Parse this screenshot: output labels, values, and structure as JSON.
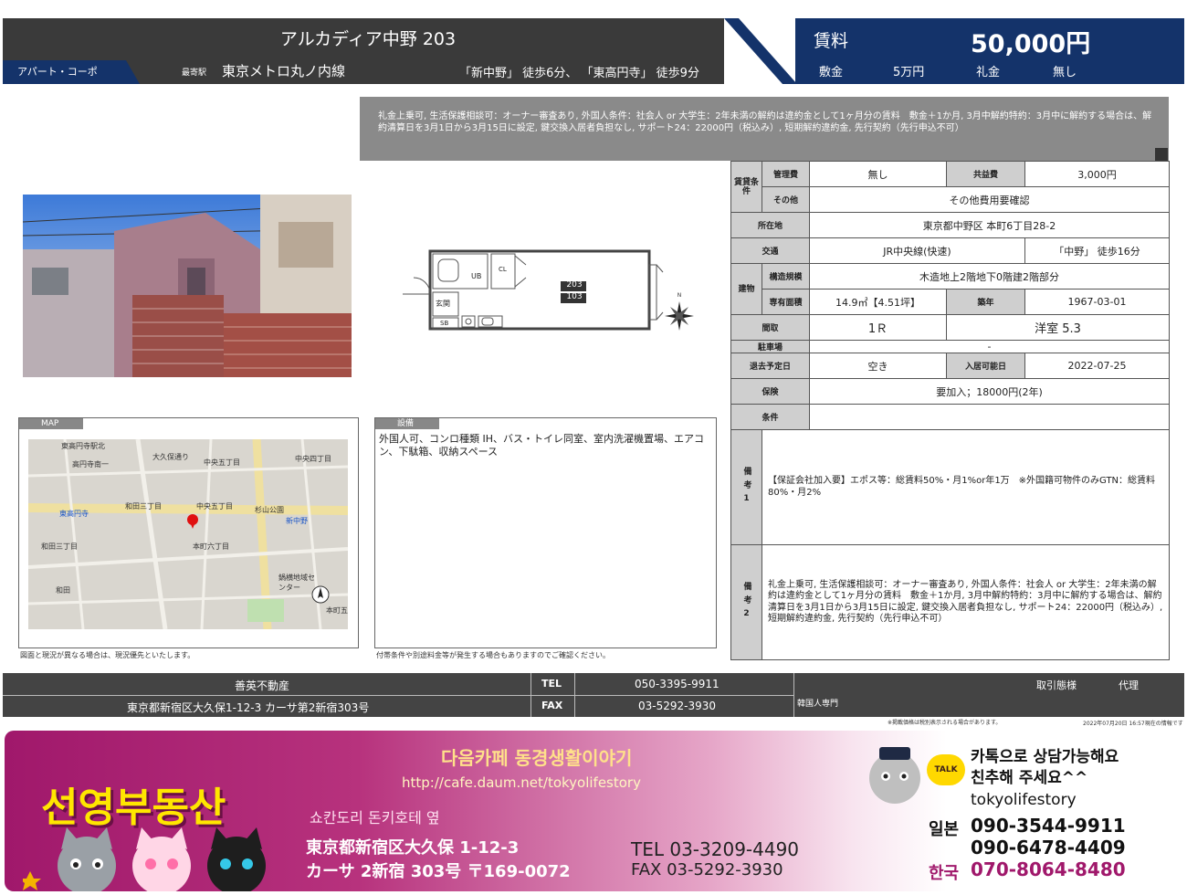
{
  "header": {
    "title": "アルカディア中野 203",
    "type": "アパート・コーポ",
    "nearest_label": "最寄駅",
    "station": "東京メトロ丸ノ内線",
    "walk": "「新中野」 徒歩6分、 「東高円寺」 徒歩9分",
    "rent_label": "賃料",
    "rent": "50,000円",
    "deposit_label": "敷金",
    "deposit": "5万円",
    "key_money_label": "礼金",
    "key_money": "無し"
  },
  "banner_text": "礼金上乗可, 生活保護相談可：オーナー審査あり, 外国人条件：社会人 or 大学生：2年未満の解約は違約金として1ヶ月分の賃料　敷金＋1か月, 3月中解約特約：3月中に解約する場合は、解約清算日を3月1日から3月15日に設定, 鍵交換入居者負担なし, サポート24：22000円（税込み）, 短期解約違約金, 先行契約（先行申込不可）",
  "table": {
    "lease_terms_label": "賃貸条件",
    "mgmt_fee_label": "管理費",
    "mgmt_fee": "無し",
    "common_fee_label": "共益費",
    "common_fee": "3,000円",
    "other_label": "その他",
    "other": "その他費用要確認",
    "address_label": "所在地",
    "address": "東京都中野区 本町6丁目28-2",
    "transport_label": "交通",
    "line": "JR中央線(快速)",
    "line_walk": "「中野」 徒歩16分",
    "building_label": "建物",
    "structure_label": "構造規模",
    "structure": "木造地上2階地下0階建2階部分",
    "area_label": "専有面積",
    "area": "14.9㎡【4.51坪】",
    "built_label": "築年",
    "built": "1967-03-01",
    "layout_label": "間取",
    "layout": "1Ｒ",
    "room": "洋室 5.3",
    "parking_label": "駐車場",
    "parking": "-",
    "moveout_label": "退去予定日",
    "moveout": "空き",
    "movein_label": "入居可能日",
    "movein": "2022-07-25",
    "insurance_label": "保険",
    "insurance": "要加入；18000円(2年)",
    "conditions_label": "条件",
    "conditions": "",
    "remark1_label": "備考1",
    "remark1": "【保証会社加入要】エポス等：総賃料50%・月1%or年1万　※外国籍可物件のみGTN：総賃料80%・月2%",
    "remark2_label": "備考2",
    "remark2": "礼金上乗可, 生活保護相談可：オーナー審査あり, 外国人条件：社会人 or 大学生：2年未満の解約は違約金として1ヶ月分の賃料　敷金＋1か月, 3月中解約特約：3月中に解約する場合は、解約清算日を3月1日から3月15日に設定, 鍵交換入居者負担なし, サポート24：22000円（税込み）, 短期解約違約金, 先行契約（先行申込不可）"
  },
  "floorplan": {
    "room_top": "203",
    "room_bottom": "103",
    "ub": "UB",
    "cl": "CL",
    "entrance": "玄関",
    "sb": "SB"
  },
  "map": {
    "label": "MAP",
    "note": "図面と現況が異なる場合は、現況優先といたします。",
    "places": {
      "p1": "東高円寺駅北",
      "p2": "高円寺南一",
      "p3": "大久保通り",
      "p4": "中央五丁目",
      "p5": "中央四丁目",
      "p6": "和田三丁目",
      "p7": "中央五丁目",
      "p8": "杉山公園",
      "p9": "新中野",
      "p10": "東高円寺",
      "p11": "本町六丁目",
      "p12": "和田三丁目",
      "p13": "鍋横地域センター",
      "p14": "和田",
      "p15": "本町五"
    }
  },
  "facilities": {
    "label": "設備",
    "text": "外国人可、コンロ種類 IH、バス・トイレ同室、室内洗濯機置場、エアコン、下駄箱、収納スペース",
    "note": "付帯条件や別途料金等が発生する場合もありますのでご確認ください。"
  },
  "agency": {
    "name": "善英不動産",
    "address": "東京都新宿区大久保1-12-3 カーサ第2新宿303号",
    "tel_label": "TEL",
    "tel": "050-3395-9911",
    "fax_label": "FAX",
    "fax": "03-5292-3930",
    "deal_label": "取引態様",
    "deal": "代理",
    "korean": "韓国人専門",
    "fine1": "※掲載価格は税別表示される場合があります。",
    "fine2": "2022年07月20日 16:57現在の情報です"
  },
  "promo": {
    "cafe": "다음카페 동경생활이야기",
    "url": "http://cafe.daum.net/tokyolifestory",
    "brand": "선영부동산",
    "location": "쇼칸도리 돈키호테 옆",
    "addr1": "東京都新宿区大久保 1-12-3",
    "addr2": "カーサ 2新宿 303号 〒169-0072",
    "tel": "TEL 03-3209-4490",
    "fax": "FAX 03-5292-3930",
    "talk_icon_text": "TALK",
    "kakao1": "카톡으로 상담가능해요",
    "kakao2": "친추해 주세요^^",
    "kakao_id": "tokyolifestory",
    "jp_label": "일본",
    "jp_tel1": "090-3544-9911",
    "jp_tel2": "090-6478-4409",
    "kr_label": "한국",
    "kr_tel": "070-8064-8480",
    "colors": {
      "brand_yellow": "#ffe600",
      "magenta": "#a0186b"
    }
  }
}
